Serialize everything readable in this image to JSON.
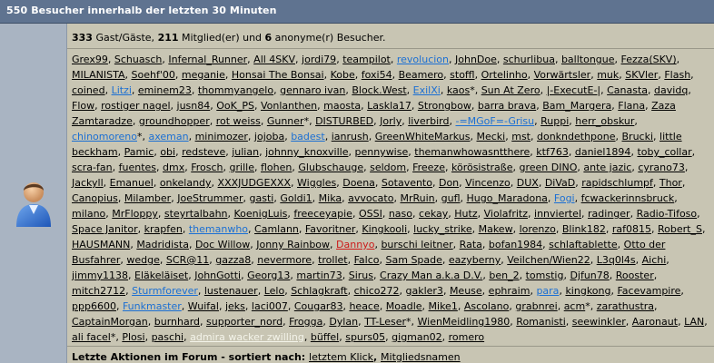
{
  "header": {
    "title": "550 Besucher innerhalb der letzten 30 Minuten"
  },
  "stats": {
    "guests_count": "333",
    "guests_label": " Gast/Gäste, ",
    "members_count": "211",
    "members_label": " Mitglied(er) und ",
    "anon_count": "6",
    "anon_label": " anonyme(r) Besucher."
  },
  "users": [
    {
      "name": "Grex99"
    },
    {
      "name": "Schuasch"
    },
    {
      "name": "Infernal_Runner"
    },
    {
      "name": "All 4SKV"
    },
    {
      "name": "jordi79"
    },
    {
      "name": "teampilot"
    },
    {
      "name": "revolucion",
      "color": "blue"
    },
    {
      "name": "JohnDoe"
    },
    {
      "name": "schurlibua"
    },
    {
      "name": "balltongue"
    },
    {
      "name": "Fezza(SKV)"
    },
    {
      "name": "MILANISTA"
    },
    {
      "name": "Soehf'00"
    },
    {
      "name": "meganie"
    },
    {
      "name": "Honsai The Bonsai"
    },
    {
      "name": "Kobe"
    },
    {
      "name": "foxi54"
    },
    {
      "name": "Beamero"
    },
    {
      "name": "stoffl"
    },
    {
      "name": "Ortelinho"
    },
    {
      "name": "Vorwärtsler"
    },
    {
      "name": "muk"
    },
    {
      "name": "SKVler"
    },
    {
      "name": "Flash"
    },
    {
      "name": "coined"
    },
    {
      "name": "Litzi",
      "color": "blue"
    },
    {
      "name": "eminem23"
    },
    {
      "name": "thommyangelo"
    },
    {
      "name": "gennaro ivan"
    },
    {
      "name": "Block.West"
    },
    {
      "name": "ExilXi",
      "color": "blue"
    },
    {
      "name": "kaos",
      "suffix": "*"
    },
    {
      "name": "Sun At Zero"
    },
    {
      "name": "|-ExecutE-|"
    },
    {
      "name": "Canasta"
    },
    {
      "name": "davidq"
    },
    {
      "name": "Flow"
    },
    {
      "name": "rostiger nagel"
    },
    {
      "name": "jusn84"
    },
    {
      "name": "OoK_PS"
    },
    {
      "name": "Vonlanthen"
    },
    {
      "name": "maosta"
    },
    {
      "name": "Laskla17"
    },
    {
      "name": "Strongbow"
    },
    {
      "name": "barra brava"
    },
    {
      "name": "Bam_Margera"
    },
    {
      "name": "Flana"
    },
    {
      "name": "Zaza Zamtaradze"
    },
    {
      "name": "groundhopper"
    },
    {
      "name": "rot weiss"
    },
    {
      "name": "Gunner",
      "suffix": "*"
    },
    {
      "name": "DISTURBED"
    },
    {
      "name": "Jorly"
    },
    {
      "name": "liverbird"
    },
    {
      "name": "-=MGoF=-Grisu",
      "color": "blue"
    },
    {
      "name": "Ruppi"
    },
    {
      "name": "herr_obskur"
    },
    {
      "name": "chinomoreno",
      "color": "blue",
      "suffix": "*"
    },
    {
      "name": "axeman",
      "color": "blue"
    },
    {
      "name": "minimozer"
    },
    {
      "name": "jojoba"
    },
    {
      "name": "badest",
      "color": "blue"
    },
    {
      "name": "ianrush"
    },
    {
      "name": "GreenWhiteMarkus"
    },
    {
      "name": "Mecki"
    },
    {
      "name": "mst"
    },
    {
      "name": "donkndethpone"
    },
    {
      "name": "Brucki"
    },
    {
      "name": "little beckham"
    },
    {
      "name": "Pamic"
    },
    {
      "name": "obi"
    },
    {
      "name": "redsteve"
    },
    {
      "name": "julian"
    },
    {
      "name": "johnny_knoxville"
    },
    {
      "name": "pennywise"
    },
    {
      "name": "themanwhowasntthere"
    },
    {
      "name": "ktf763"
    },
    {
      "name": "daniel1894"
    },
    {
      "name": "toby_collar"
    },
    {
      "name": "scra-fan"
    },
    {
      "name": "fuentes"
    },
    {
      "name": "dmx"
    },
    {
      "name": "Frosch"
    },
    {
      "name": "grille"
    },
    {
      "name": "flohen"
    },
    {
      "name": "Glubschauge"
    },
    {
      "name": "seldom"
    },
    {
      "name": "Freeze"
    },
    {
      "name": "körösistraße"
    },
    {
      "name": "green DINO"
    },
    {
      "name": "ante jazic"
    },
    {
      "name": "cyrano73"
    },
    {
      "name": "Jackyll"
    },
    {
      "name": "Emanuel"
    },
    {
      "name": "onkelandy"
    },
    {
      "name": "XXXJUDGEXXX"
    },
    {
      "name": "Wiggles"
    },
    {
      "name": "Doena"
    },
    {
      "name": "Sotavento"
    },
    {
      "name": "Don"
    },
    {
      "name": "Vincenzo"
    },
    {
      "name": "DUX"
    },
    {
      "name": "DiVaD"
    },
    {
      "name": "rapidschlumpf"
    },
    {
      "name": "Thor"
    },
    {
      "name": "Canopius"
    },
    {
      "name": "Milamber"
    },
    {
      "name": "JoeStrummer"
    },
    {
      "name": "gasti"
    },
    {
      "name": "Goldi1"
    },
    {
      "name": "Mika"
    },
    {
      "name": "avvocato"
    },
    {
      "name": "MrRuin"
    },
    {
      "name": "gufl"
    },
    {
      "name": "Hugo_Maradona"
    },
    {
      "name": "Fogi",
      "color": "blue"
    },
    {
      "name": "fcwackerinnsbruck"
    },
    {
      "name": "milano"
    },
    {
      "name": "MrFloppy"
    },
    {
      "name": "steyrtalbahn"
    },
    {
      "name": "KoenigLuis"
    },
    {
      "name": "freeceyapie"
    },
    {
      "name": "OSSI"
    },
    {
      "name": "naso"
    },
    {
      "name": "cekay"
    },
    {
      "name": "Hutz"
    },
    {
      "name": "Violafritz"
    },
    {
      "name": "innviertel"
    },
    {
      "name": "radinger"
    },
    {
      "name": "Radio-Tifoso"
    },
    {
      "name": "Space Janitor"
    },
    {
      "name": "krapfen"
    },
    {
      "name": "themanwho",
      "color": "blue"
    },
    {
      "name": "Camlann"
    },
    {
      "name": "Favoritner"
    },
    {
      "name": "Kingkooli"
    },
    {
      "name": "lucky_strike"
    },
    {
      "name": "Makew"
    },
    {
      "name": "lorenzo"
    },
    {
      "name": "Blink182"
    },
    {
      "name": "raf0815"
    },
    {
      "name": "Robert_S"
    },
    {
      "name": "HAUSMANN"
    },
    {
      "name": "Madridista"
    },
    {
      "name": "Doc Willow"
    },
    {
      "name": "Jonny Rainbow"
    },
    {
      "name": "Dannyo",
      "color": "red"
    },
    {
      "name": "burschi leitner"
    },
    {
      "name": "Rata"
    },
    {
      "name": "bofan1984"
    },
    {
      "name": "schlaftablette"
    },
    {
      "name": "Otto der Busfahrer"
    },
    {
      "name": "wedge"
    },
    {
      "name": "SCR@11"
    },
    {
      "name": "gazza8"
    },
    {
      "name": "nevermore"
    },
    {
      "name": "trollet"
    },
    {
      "name": "Falco"
    },
    {
      "name": "Sam Spade"
    },
    {
      "name": "eazyberny"
    },
    {
      "name": "Veilchen/Wien22"
    },
    {
      "name": "L3q0l4s"
    },
    {
      "name": "Aichi"
    },
    {
      "name": "jimmy1138"
    },
    {
      "name": "Eläkeläiset"
    },
    {
      "name": "JohnGotti"
    },
    {
      "name": "Georg13"
    },
    {
      "name": "martin73"
    },
    {
      "name": "Sirus"
    },
    {
      "name": "Crazy Man a.k.a D.V."
    },
    {
      "name": "ben_2"
    },
    {
      "name": "tomstig"
    },
    {
      "name": "Djfun78"
    },
    {
      "name": "Rooster"
    },
    {
      "name": "mitch2712"
    },
    {
      "name": "Sturmforever",
      "color": "blue"
    },
    {
      "name": "lustenauer"
    },
    {
      "name": "Lelo"
    },
    {
      "name": "Schlagkraft"
    },
    {
      "name": "chico272"
    },
    {
      "name": "gakler3"
    },
    {
      "name": "Meuse"
    },
    {
      "name": "ephraim"
    },
    {
      "name": "para",
      "color": "blue"
    },
    {
      "name": "kingkong"
    },
    {
      "name": "Facevampire"
    },
    {
      "name": "ppp6600"
    },
    {
      "name": "Funkmaster",
      "color": "blue"
    },
    {
      "name": "Wuifal"
    },
    {
      "name": "jeks"
    },
    {
      "name": "laci007"
    },
    {
      "name": "Cougar83"
    },
    {
      "name": "heace"
    },
    {
      "name": "Moadle"
    },
    {
      "name": "Mike1"
    },
    {
      "name": "Ascolano"
    },
    {
      "name": "grabnrei"
    },
    {
      "name": "acm",
      "suffix": "*"
    },
    {
      "name": "zarathustra"
    },
    {
      "name": "CaptainMorgan"
    },
    {
      "name": "burnhard"
    },
    {
      "name": "supporter_nord"
    },
    {
      "name": "Frogga"
    },
    {
      "name": "Dylan"
    },
    {
      "name": "TT-Leser",
      "suffix": "*"
    },
    {
      "name": "WienMeidling1980"
    },
    {
      "name": "Romanisti"
    },
    {
      "name": "seewinkler"
    },
    {
      "name": "Aaronaut"
    },
    {
      "name": "LAN"
    },
    {
      "name": "ali facel",
      "suffix": "*"
    },
    {
      "name": "Plosi"
    },
    {
      "name": "paschi"
    },
    {
      "name": "admira wacker zwilling",
      "color": "white"
    },
    {
      "name": "büffel"
    },
    {
      "name": "spurs05"
    },
    {
      "name": "gigman02"
    },
    {
      "name": "romero"
    }
  ],
  "actions": {
    "prefix": "Letzte Aktionen im Forum - sortiert nach: ",
    "sort_click": "letztem Klick",
    "separator": ", ",
    "sort_names": "Mitgliedsnamen"
  }
}
